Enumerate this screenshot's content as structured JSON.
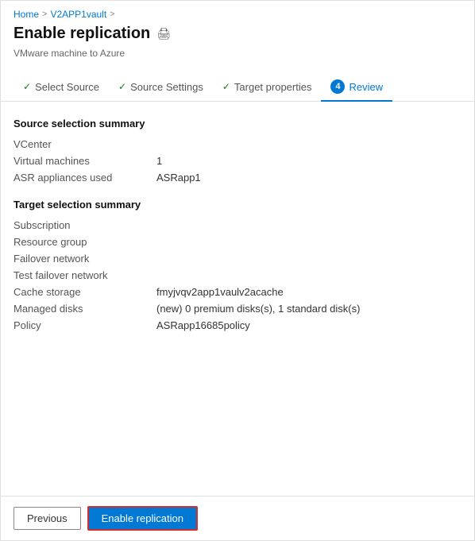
{
  "breadcrumb": {
    "home": "Home",
    "separator1": ">",
    "vault": "V2APP1vault",
    "separator2": ">"
  },
  "header": {
    "title": "Enable replication",
    "subtitle": "VMware machine to Azure",
    "icon": "🖨"
  },
  "tabs": [
    {
      "id": "select-source",
      "label": "Select Source",
      "check": true,
      "active": false,
      "num": null
    },
    {
      "id": "source-settings",
      "label": "Source Settings",
      "check": true,
      "active": false,
      "num": null
    },
    {
      "id": "target-properties",
      "label": "Target properties",
      "check": true,
      "active": false,
      "num": null
    },
    {
      "id": "review",
      "label": "Review",
      "check": false,
      "active": true,
      "num": "4"
    }
  ],
  "source_section": {
    "title": "Source selection summary",
    "rows": [
      {
        "label": "VCenter",
        "value": ""
      },
      {
        "label": "Virtual machines",
        "value": "1"
      },
      {
        "label": "ASR appliances used",
        "value": "ASRapp1"
      }
    ]
  },
  "target_section": {
    "title": "Target selection summary",
    "rows": [
      {
        "label": "Subscription",
        "value": ""
      },
      {
        "label": "Resource group",
        "value": ""
      },
      {
        "label": "Failover network",
        "value": ""
      },
      {
        "label": "Test failover network",
        "value": ""
      },
      {
        "label": "Cache storage",
        "value": "fmyjvqv2app1vaulv2acache"
      },
      {
        "label": "Managed disks",
        "value": "(new) 0 premium disks(s), 1 standard disk(s)"
      },
      {
        "label": "Policy",
        "value": "ASRapp16685policy"
      }
    ]
  },
  "footer": {
    "previous_label": "Previous",
    "enable_label": "Enable replication"
  }
}
